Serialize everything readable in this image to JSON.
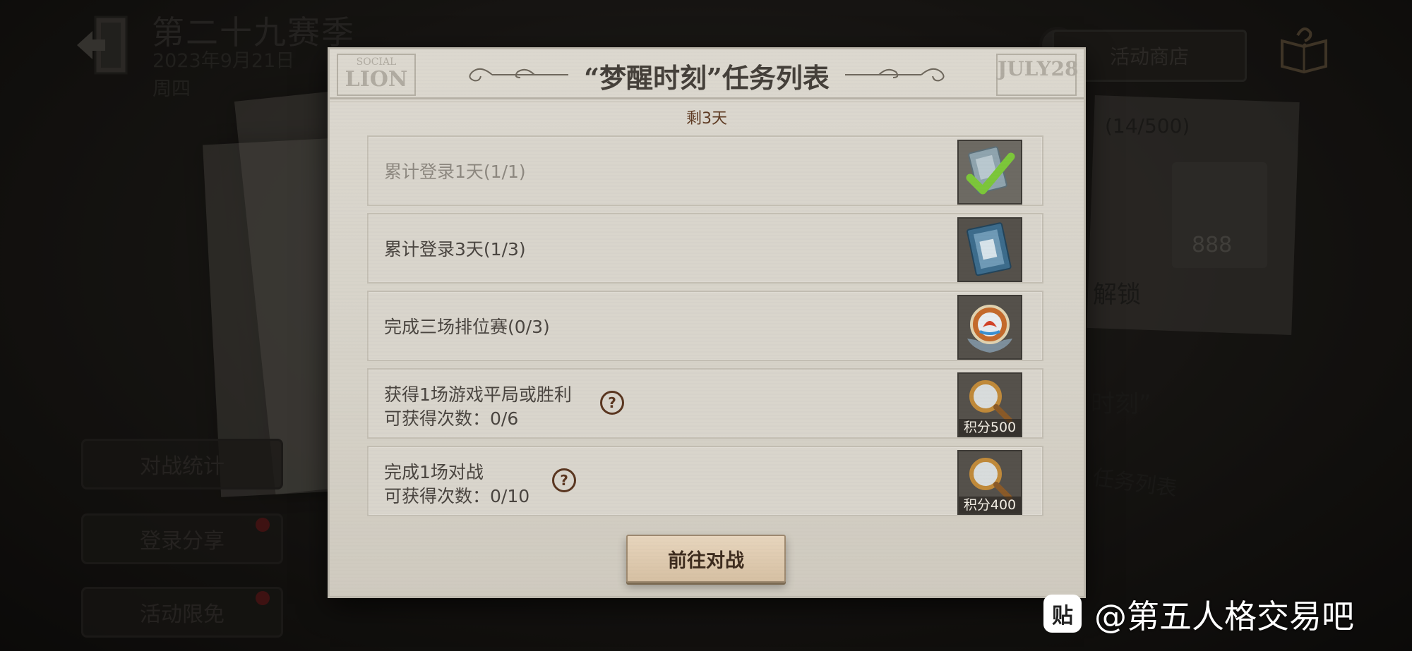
{
  "header": {
    "season_title": "第二十九赛季",
    "date": "2023年9月21日",
    "weekday": "周四",
    "shop_label": "活动商店"
  },
  "side_menu": {
    "battle_stats": "对战统计",
    "login_share": "登录分享",
    "event_free": "活动限免"
  },
  "background_card": {
    "progress": "(14/500)",
    "puzzle_number": "888",
    "unlock": "解锁",
    "moment": "时刻”",
    "task_list": "任务列表"
  },
  "dialog": {
    "title": "“梦醒时刻”任务列表",
    "remaining": "剩3天",
    "masthead_left_top": "SOCIAL",
    "masthead_left_big": "LION",
    "masthead_right": "JULY28",
    "go_button": "前往对战",
    "tasks": [
      {
        "text": "累计登录1天(1/1)",
        "completed": true,
        "reward_icon": "check-card-icon"
      },
      {
        "text": "累计登录3天(1/3)",
        "completed": false,
        "reward_icon": "blue-card-icon"
      },
      {
        "text": "完成三场排位赛(0/3)",
        "completed": false,
        "reward_icon": "medal-icon"
      },
      {
        "line1": "获得1场游戏平局或胜利",
        "line2": "可获得次数：0/6",
        "completed": false,
        "reward_icon": "magnifier-icon",
        "points": "积分500"
      },
      {
        "line1": "完成1场对战",
        "line2": "可获得次数：0/10",
        "completed": false,
        "reward_icon": "magnifier-icon",
        "points": "积分400"
      }
    ]
  },
  "watermark": {
    "icon": "贴",
    "text": "@第五人格交易吧"
  },
  "colors": {
    "dialog_paper": "#d6d2c8",
    "remaining_text": "#5e3a22",
    "button_face": "#e7d5bd",
    "check_green": "#7cc63a"
  }
}
